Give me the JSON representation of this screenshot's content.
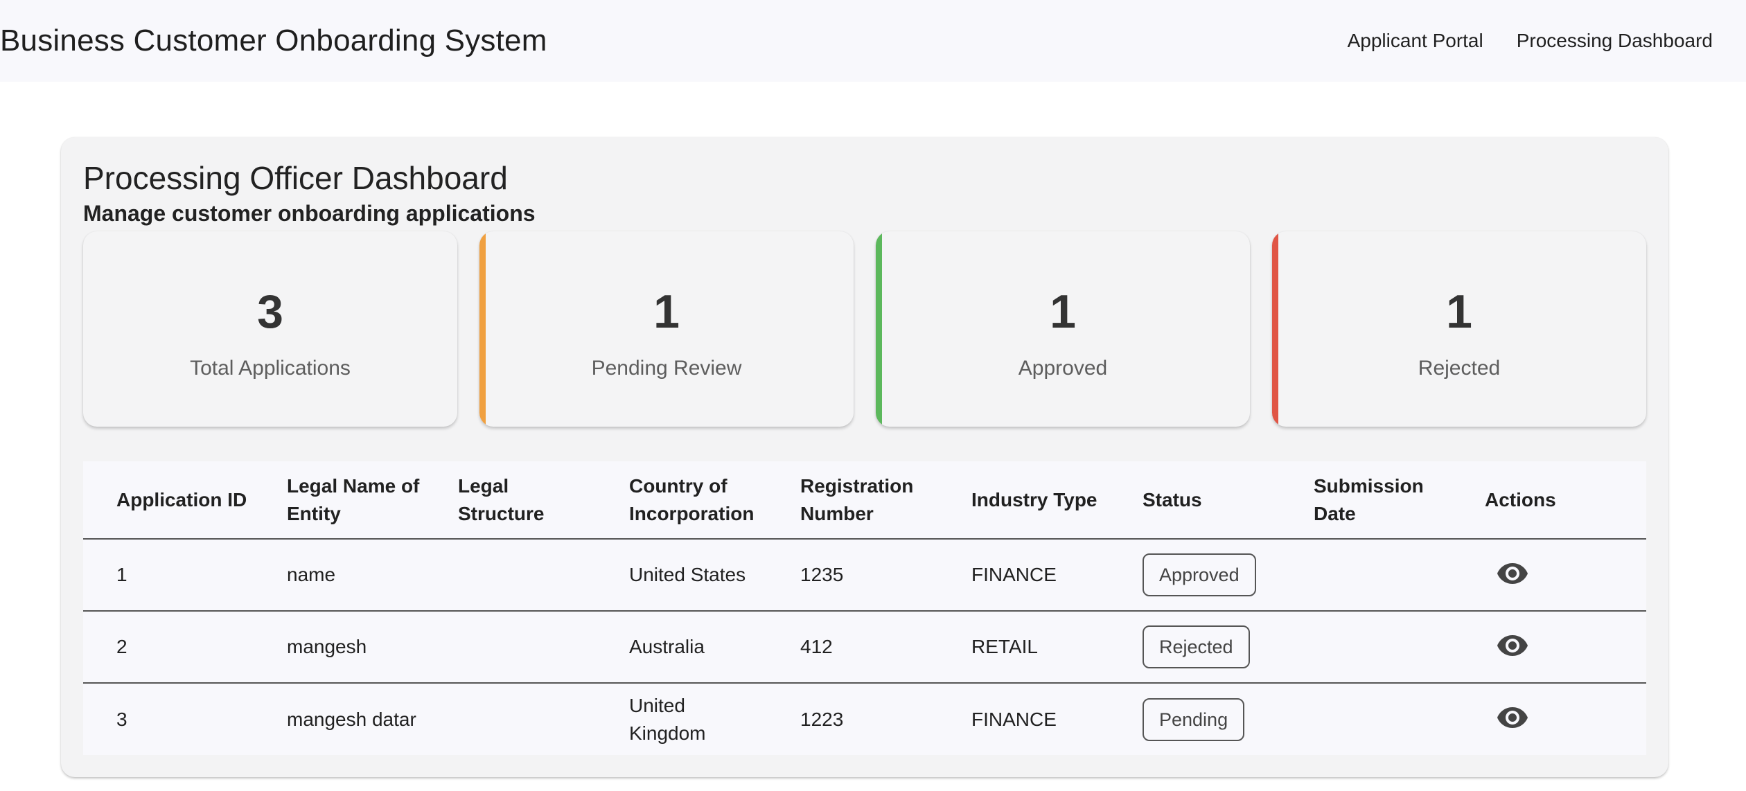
{
  "header": {
    "title": "Business Customer Onboarding System",
    "nav": [
      {
        "label": "Applicant Portal"
      },
      {
        "label": "Processing Dashboard"
      }
    ]
  },
  "dashboard": {
    "title": "Processing Officer Dashboard",
    "subtitle": "Manage customer onboarding applications"
  },
  "stats": [
    {
      "value": "3",
      "label": "Total Applications",
      "accent": ""
    },
    {
      "value": "1",
      "label": "Pending Review",
      "accent": "#f0a040"
    },
    {
      "value": "1",
      "label": "Approved",
      "accent": "#5cb85c"
    },
    {
      "value": "1",
      "label": "Rejected",
      "accent": "#e05545"
    }
  ],
  "table": {
    "columns": [
      "Application ID",
      "Legal Name of Entity",
      "Legal Structure",
      "Country of Incorporation",
      "Registration Number",
      "Industry Type",
      "Status",
      "Submission Date",
      "Actions"
    ],
    "rows": [
      {
        "id": "1",
        "name": "name",
        "structure": "",
        "country": "United States",
        "reg": "1235",
        "industry": "FINANCE",
        "status": "Approved",
        "date": "",
        "action_icon": "eye-icon"
      },
      {
        "id": "2",
        "name": "mangesh",
        "structure": "",
        "country": "Australia",
        "reg": "412",
        "industry": "RETAIL",
        "status": "Rejected",
        "date": "",
        "action_icon": "eye-icon"
      },
      {
        "id": "3",
        "name": "mangesh datar",
        "structure": "",
        "country": "United Kingdom",
        "reg": "1223",
        "industry": "FINANCE",
        "status": "Pending",
        "date": "",
        "action_icon": "eye-icon"
      }
    ]
  }
}
